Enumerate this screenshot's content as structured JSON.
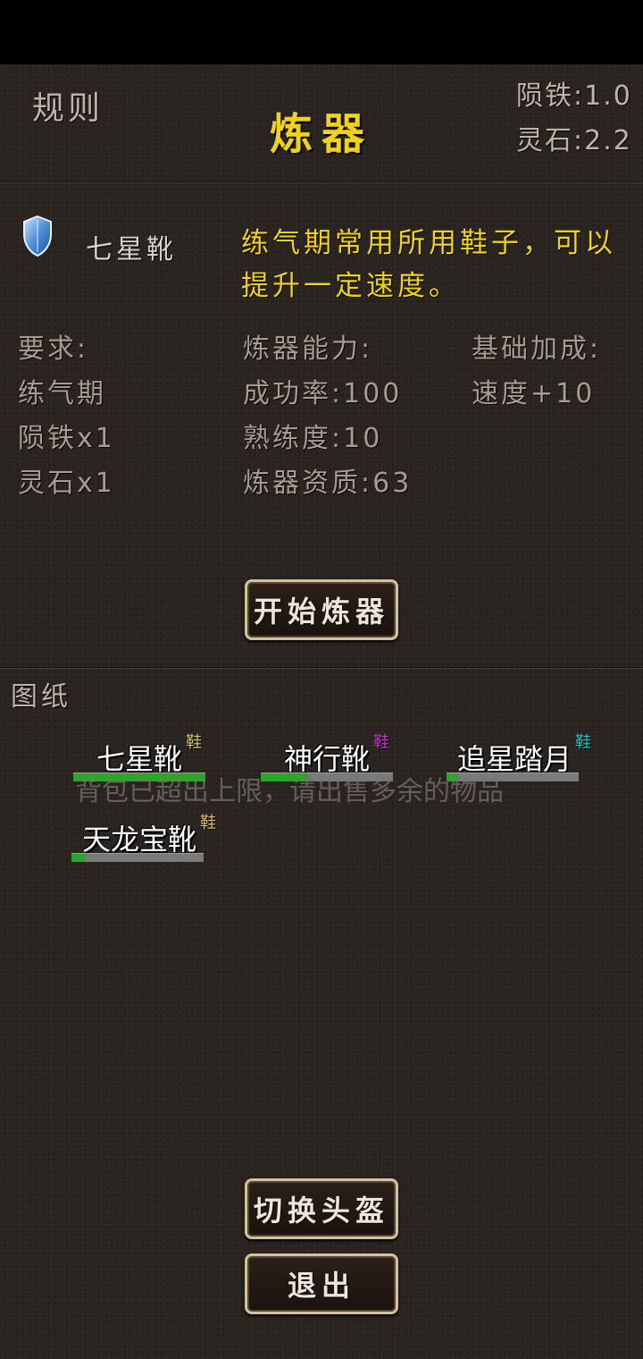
{
  "header": {
    "rules_label": "规则",
    "title": "炼器",
    "resources": {
      "iron": "陨铁:1.0",
      "spirit_stone": "灵石:2.2"
    }
  },
  "item": {
    "icon": "shield-icon",
    "name": "七星靴",
    "description": "练气期常用所用鞋子，可以提升一定速度。"
  },
  "requirements": {
    "heading": "要求:",
    "lines": [
      "练气期",
      "陨铁x1",
      "灵石x1"
    ]
  },
  "ability": {
    "heading": "炼器能力:",
    "lines": [
      "成功率:100",
      "熟练度:10",
      "炼器资质:63"
    ]
  },
  "bonus": {
    "heading": "基础加成:",
    "lines": [
      "速度+10"
    ]
  },
  "start_button": "开始炼器",
  "blueprints": {
    "label": "图纸",
    "items": [
      {
        "name": "七星靴",
        "tag": "鞋",
        "tag_color": "#d8c070",
        "progress": 1.0
      },
      {
        "name": "神行靴",
        "tag": "鞋",
        "tag_color": "#d030d8",
        "progress": 0.35
      },
      {
        "name": "追星踏月",
        "tag": "鞋",
        "tag_color": "#20c8c8",
        "progress": 0.08
      },
      {
        "name": "天龙宝靴",
        "tag": "鞋",
        "tag_color": "#d8c070",
        "progress": 0.1
      }
    ]
  },
  "toast": "背包已超出上限，请出售多余的物品",
  "switch_button": "切换头盔",
  "exit_button": "退出",
  "colors": {
    "accent": "#f0d21a",
    "progress": "#2da52a"
  }
}
